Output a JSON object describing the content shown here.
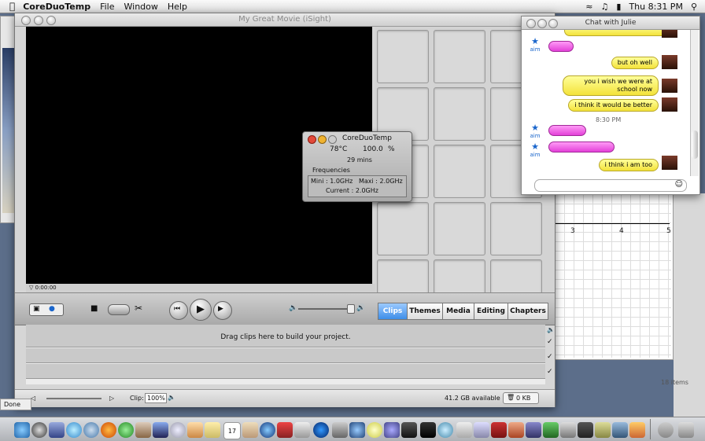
{
  "menubar": {
    "app_name": "CoreDuoTemp",
    "items": [
      "File",
      "Window",
      "Help"
    ],
    "clock": "Thu 8:31 PM"
  },
  "imovie": {
    "title": "My Great Movie (iSight)",
    "timecode": "0:00:00",
    "tabs": [
      "Clips",
      "Themes",
      "Media",
      "Editing",
      "Chapters"
    ],
    "active_tab": "Clips",
    "timeline_hint": "Drag clips here to build your project.",
    "clip_label": "Clip:",
    "zoom_value": "100%",
    "disk_available": "41.2 GB available",
    "trash_size": "0 KB"
  },
  "coreduotemp": {
    "title": "CoreDuoTemp",
    "temperature": "78°C",
    "load": "100.0",
    "load_unit": "%",
    "duration": "29 mins",
    "freq_label": "Frequencies",
    "mini": "Mini : 1.0GHz",
    "maxi": "Maxi : 2.0GHz",
    "current": "Current : 2.0GHz"
  },
  "chat": {
    "title": "Chat with Julie",
    "aim_label": "aim",
    "messages": [
      {
        "from": "me",
        "text": "but oh well"
      },
      {
        "from": "me",
        "text": "you i wish we were at school now"
      },
      {
        "from": "me",
        "text": "i think it would be better"
      },
      {
        "from": "time",
        "text": "8:30 PM"
      },
      {
        "from": "me",
        "text": "i think i am too"
      }
    ]
  },
  "graph": {
    "ticks": [
      "3",
      "4",
      "5"
    ],
    "items_count": "18 items"
  },
  "status": {
    "done": "Done"
  },
  "dock": {
    "calendar_day": "17"
  }
}
